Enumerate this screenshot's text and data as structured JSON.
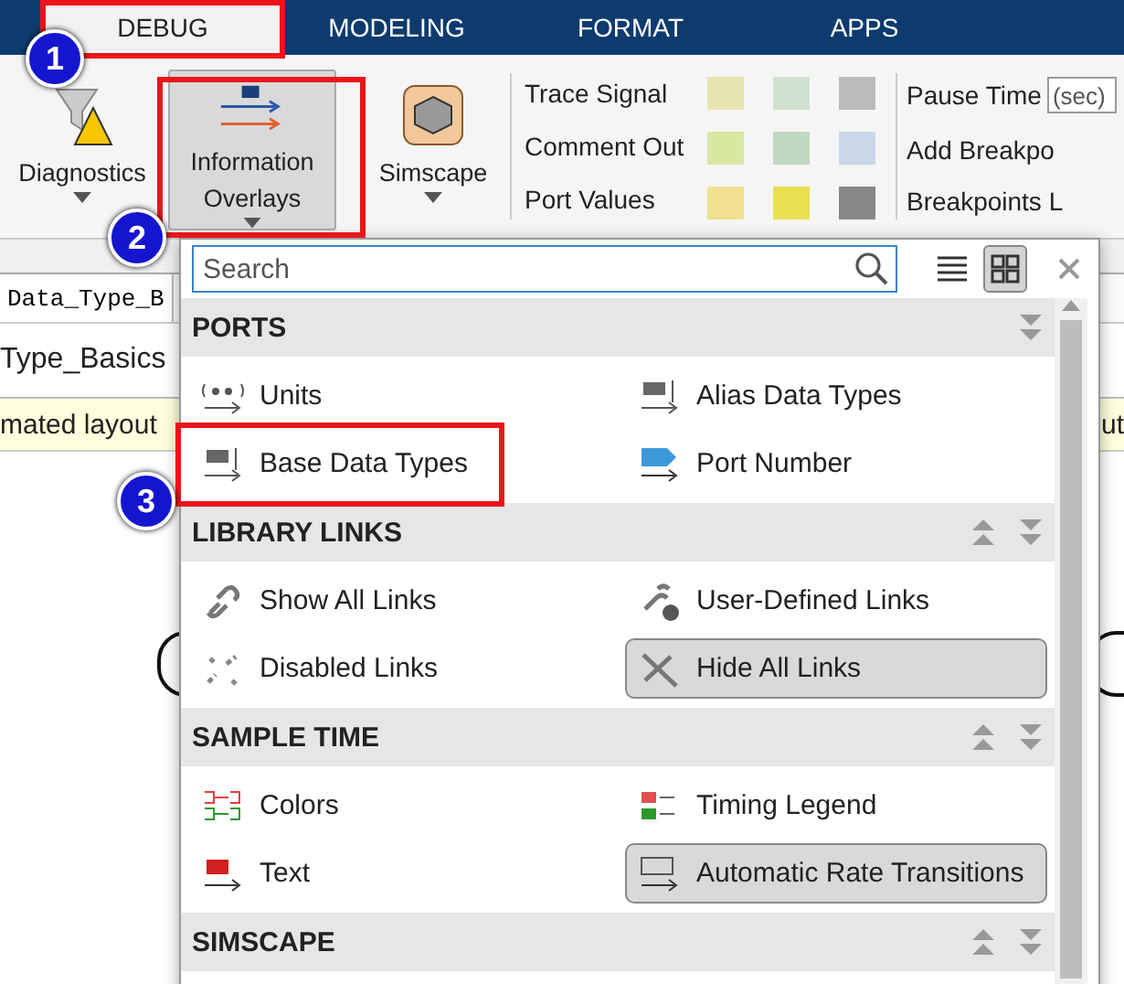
{
  "tabs": [
    {
      "label": "DEBUG",
      "selected": true
    },
    {
      "label": "MODELING",
      "selected": false
    },
    {
      "label": "FORMAT",
      "selected": false
    },
    {
      "label": "APPS",
      "selected": false
    }
  ],
  "ribbon": {
    "big_buttons": [
      {
        "kind": "diagnostics",
        "label": "Diagnostics",
        "pressed": false
      },
      {
        "kind": "overlays",
        "label": "Information Overlays",
        "pressed": true
      },
      {
        "kind": "simscape",
        "label": "Simscape",
        "pressed": false
      }
    ],
    "commands": [
      "Trace Signal",
      "Comment Out",
      "Port Values"
    ],
    "pause_time": {
      "label": "Pause Time",
      "placeholder": "(sec)"
    },
    "breakpoints": [
      "Add Breakpo",
      "Breakpoints L"
    ]
  },
  "model": {
    "breadcrumb": "Data_Type_B",
    "path": "Type_Basics",
    "info_left": "mated layout",
    "info_right": "ut"
  },
  "popup": {
    "search": {
      "placeholder": "Search"
    },
    "view": [
      {
        "kind": "list",
        "selected": false
      },
      {
        "kind": "grid",
        "selected": true
      }
    ],
    "sections": [
      {
        "title": "PORTS",
        "up_arrow": false,
        "items": [
          {
            "kind": "rad",
            "label": "Units",
            "selected": false
          },
          {
            "kind": "int",
            "label": "Alias Data Types",
            "selected": false
          },
          {
            "kind": "int",
            "label": "Base Data Types",
            "selected": false
          },
          {
            "kind": "port",
            "label": "Port Number",
            "selected": false
          }
        ]
      },
      {
        "title": "LIBRARY LINKS",
        "up_arrow": true,
        "items": [
          {
            "kind": "link",
            "label": "Show All Links",
            "selected": false
          },
          {
            "kind": "userlink",
            "label": "User-Defined Links",
            "selected": false
          },
          {
            "kind": "brokenlink",
            "label": "Disabled Links",
            "selected": false
          },
          {
            "kind": "hidelink",
            "label": "Hide All Links",
            "selected": true
          }
        ]
      },
      {
        "title": "SAMPLE TIME",
        "up_arrow": true,
        "items": [
          {
            "kind": "colors",
            "label": "Colors",
            "selected": false
          },
          {
            "kind": "legend",
            "label": "Timing Legend",
            "selected": false
          },
          {
            "kind": "d1",
            "label": "Text",
            "selected": false
          },
          {
            "kind": "zoh",
            "label": "Automatic Rate Transitions",
            "selected": true
          }
        ]
      },
      {
        "title": "SIMSCAPE",
        "up_arrow": true
      }
    ]
  },
  "annotations": [
    {
      "number": "1"
    },
    {
      "number": "2"
    },
    {
      "number": "3"
    }
  ]
}
